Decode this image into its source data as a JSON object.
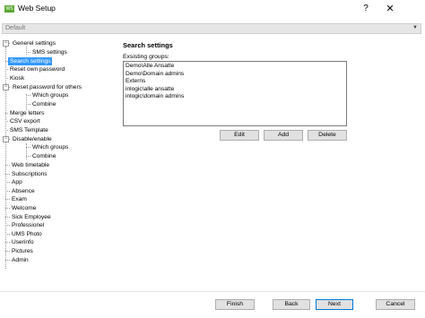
{
  "window": {
    "app_icon_text": "WS",
    "title": "Web Setup",
    "help_label": "?",
    "close_label": "✕"
  },
  "profile": {
    "selected": "Default"
  },
  "tree": {
    "items": [
      {
        "label": "Generel settings"
      },
      {
        "label": "SMS settings"
      },
      {
        "label": "Search settings"
      },
      {
        "label": "Reset own password"
      },
      {
        "label": "Kiosk"
      },
      {
        "label": "Reset password for others"
      },
      {
        "label": "Which groups"
      },
      {
        "label": "Combine"
      },
      {
        "label": "Merge letters"
      },
      {
        "label": "CSV export"
      },
      {
        "label": "SMS Template"
      },
      {
        "label": "Disable/enable"
      },
      {
        "label": "Which groups"
      },
      {
        "label": "Combine"
      },
      {
        "label": "Web timetable"
      },
      {
        "label": "Subscriptions"
      },
      {
        "label": "App"
      },
      {
        "label": "Absence"
      },
      {
        "label": "Exam"
      },
      {
        "label": "Welcome"
      },
      {
        "label": "Sick Employee"
      },
      {
        "label": "Professionel"
      },
      {
        "label": "UMS Photo"
      },
      {
        "label": "Userinfo"
      },
      {
        "label": "Pictures"
      },
      {
        "label": "Admin"
      }
    ]
  },
  "main": {
    "section_title": "Search settings",
    "groups_label": "Exsisting groups:",
    "groups": [
      "Demo\\Alle Ansatte",
      "Demo\\Domain admins",
      "Externs",
      "inlogic\\alle ansatte",
      "inlogic\\domain admins"
    ],
    "edit_label": "Edit",
    "add_label": "Add",
    "delete_label": "Delete"
  },
  "footer": {
    "finish_label": "Finish",
    "back_label": "Back",
    "next_label": "Next",
    "cancel_label": "Cancel"
  },
  "colors": {
    "selection": "#3399ff",
    "app_icon": "#5aa832"
  }
}
